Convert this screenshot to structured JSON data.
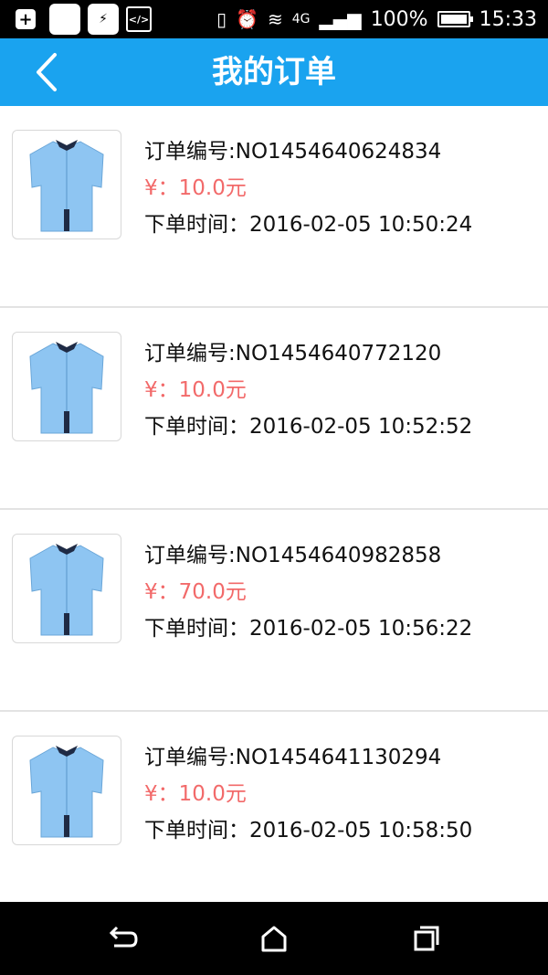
{
  "status_bar": {
    "battery": "100%",
    "time": "15:33",
    "network": "4G"
  },
  "header": {
    "title": "我的订单"
  },
  "orders": [
    {
      "order_no": "订单编号:NO1454640624834",
      "price": "¥：10.0元",
      "time": "下单时间：2016-02-05 10:50:24"
    },
    {
      "order_no": "订单编号:NO1454640772120",
      "price": "¥：10.0元",
      "time": "下单时间：2016-02-05 10:52:52"
    },
    {
      "order_no": "订单编号:NO1454640982858",
      "price": "¥：70.0元",
      "time": "下单时间：2016-02-05 10:56:22"
    },
    {
      "order_no": "订单编号:NO1454641130294",
      "price": "¥：10.0元",
      "time": "下单时间：2016-02-05 10:58:50"
    }
  ],
  "colors": {
    "header_bg": "#1aa3ef",
    "price": "#f26a6a",
    "shirt": "#8ec5f2"
  }
}
